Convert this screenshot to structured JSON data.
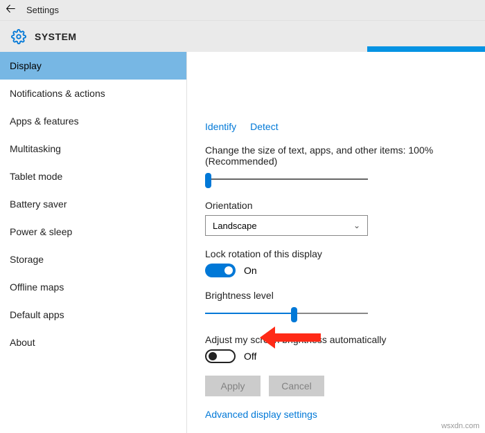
{
  "header": {
    "title": "Settings"
  },
  "category": {
    "label": "SYSTEM"
  },
  "sidebar": {
    "items": [
      {
        "label": "Display",
        "selected": true
      },
      {
        "label": "Notifications & actions"
      },
      {
        "label": "Apps & features"
      },
      {
        "label": "Multitasking"
      },
      {
        "label": "Tablet mode"
      },
      {
        "label": "Battery saver"
      },
      {
        "label": "Power & sleep"
      },
      {
        "label": "Storage"
      },
      {
        "label": "Offline maps"
      },
      {
        "label": "Default apps"
      },
      {
        "label": "About"
      }
    ]
  },
  "content": {
    "identify_link": "Identify",
    "detect_link": "Detect",
    "size_label": "Change the size of text, apps, and other items: 100% (Recommended)",
    "orientation_label": "Orientation",
    "orientation_value": "Landscape",
    "lock_rotation_label": "Lock rotation of this display",
    "lock_rotation_value": "On",
    "brightness_label": "Brightness level",
    "auto_brightness_label": "Adjust my screen brightness automatically",
    "auto_brightness_value": "Off",
    "apply_btn": "Apply",
    "cancel_btn": "Cancel",
    "advanced_link": "Advanced display settings"
  },
  "watermark": "wsxdn.com"
}
